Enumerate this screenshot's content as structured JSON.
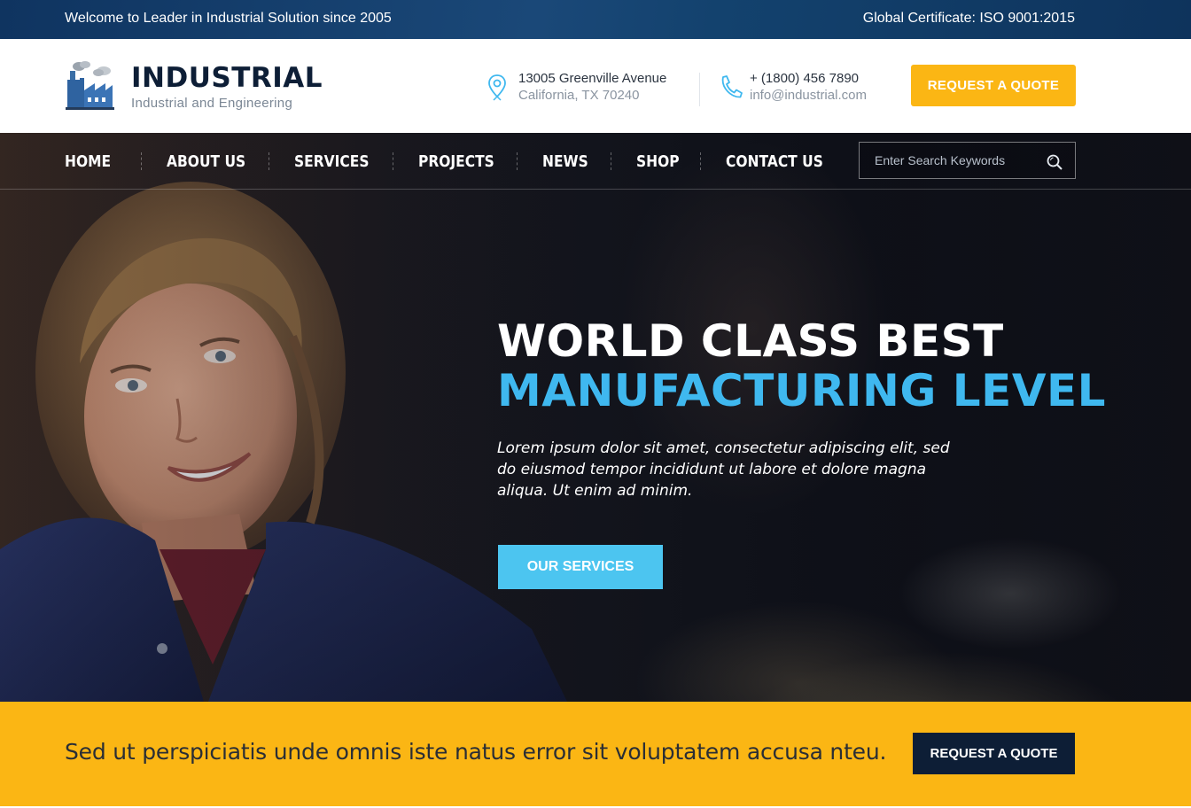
{
  "topbar": {
    "welcome": "Welcome to Leader in Industrial Solution since 2005",
    "certificate": "Global Certificate: ISO 9001:2015"
  },
  "brand": {
    "name": "INDUSTRIAL",
    "tagline": "Industrial and Engineering",
    "logo_icon": "factory-icon"
  },
  "contact": {
    "address_line1": "13005 Greenville Avenue",
    "address_line2": "California, TX 70240",
    "address_icon": "map-pin-icon",
    "phone": "+ (1800) 456 7890",
    "email": "info@industrial.com",
    "phone_icon": "phone-icon"
  },
  "header_button": "REQUEST A QUOTE",
  "nav": {
    "items": [
      "HOME",
      "ABOUT US",
      "SERVICES",
      "PROJECTS",
      "NEWS",
      "SHOP",
      "CONTACT US"
    ]
  },
  "search": {
    "placeholder": "Enter Search Keywords",
    "value": "",
    "icon": "search-icon"
  },
  "hero": {
    "title_line1": "WORLD CLASS BEST",
    "title_line2": "MANUFACTURING LEVEL",
    "description": "Lorem ipsum dolor sit amet, consectetur adipiscing elit, sed do eiusmod tempor incididunt ut labore et dolore magna aliqua. Ut enim ad minim.",
    "button": "OUR SERVICES"
  },
  "cta": {
    "text": "Sed ut perspiciatis unde omnis iste natus error sit voluptatem accusa nteu.",
    "button": "REQUEST A QUOTE"
  },
  "colors": {
    "accent_yellow": "#fbb614",
    "accent_blue": "#3fb8ef",
    "button_blue": "#4cc5f0",
    "navy": "#0d1e36",
    "topbar": "#0f3460"
  }
}
